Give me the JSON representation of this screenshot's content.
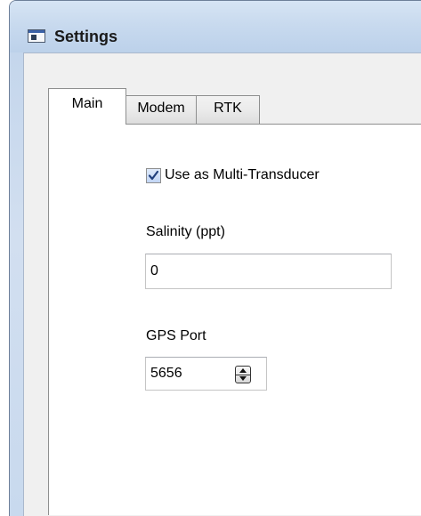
{
  "window": {
    "title": "Settings",
    "icon": "window-app-icon"
  },
  "tabs": [
    {
      "label": "Main",
      "active": true
    },
    {
      "label": "Modem",
      "active": false
    },
    {
      "label": "RTK",
      "active": false
    }
  ],
  "main": {
    "multi_transducer": {
      "label": "Use as Multi-Transducer",
      "checked": true
    },
    "salinity": {
      "label": "Salinity (ppt)",
      "value": "0"
    },
    "gps_port": {
      "label": "GPS Port",
      "value": "5656"
    }
  },
  "colors": {
    "titlebar": "#c7d9ee",
    "panel_bg": "#ffffff",
    "client_bg": "#f0f0f0",
    "check_accent": "#3b62a8"
  }
}
